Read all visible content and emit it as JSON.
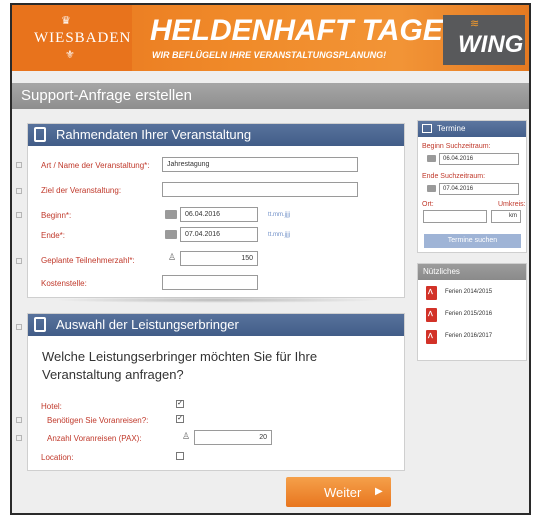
{
  "banner": {
    "logo_text": "WIESBADEN",
    "headline": "HELDENHAFT TAGEN",
    "tagline": "WIR BEFLÜGELN IHRE VERANSTALTUNGSPLANUNG!",
    "brand": "WING"
  },
  "page": {
    "title": "Support-Anfrage erstellen"
  },
  "rahmendaten": {
    "title": "Rahmendaten Ihrer Veranstaltung",
    "event_name_label": "Art / Name der Veranstaltung*:",
    "event_name_value": "Jahrestagung",
    "goal_label": "Ziel der Veranstaltung:",
    "goal_value": "",
    "start_label": "Beginn*:",
    "start_value": "06.04.2016",
    "end_label": "Ende*:",
    "end_value": "07.04.2016",
    "date_format_hint": "tt.mm.jjjj",
    "participants_label": "Geplante Teilnehmerzahl*:",
    "participants_value": "150",
    "cost_center_label": "Kostenstelle:",
    "cost_center_value": ""
  },
  "leistungen": {
    "title": "Auswahl der Leistungserbringer",
    "question": "Welche Leistungserbringer möchten Sie für Ihre Veranstaltung anfragen?",
    "hotel_label": "Hotel:",
    "hotel_checked": true,
    "preevent_label": "Benötigen Sie Voranreisen?:",
    "preevent_checked": true,
    "preevent_count_label": "Anzahl Voranreisen (PAX):",
    "preevent_count_value": "20",
    "location_label": "Location:",
    "location_checked": false,
    "check_mark": "✓"
  },
  "termine": {
    "title": "Termine",
    "start_label": "Beginn Suchzeitraum:",
    "start_value": "06.04.2016",
    "end_label": "Ende Suchzeitraum:",
    "end_value": "07.04.2016",
    "place_label": "Ort:",
    "radius_label": "Umkreis:",
    "radius_unit": "km",
    "search_button": "Termine suchen"
  },
  "nuetzliches": {
    "title": "Nützliches",
    "docs": [
      "Ferien 2014/2015",
      "Ferien 2015/2016",
      "Ferien 2016/2017"
    ]
  },
  "actions": {
    "next_label": "Weiter",
    "next_arrow": "▶"
  },
  "colors": {
    "accent_orange": "#f08b2a",
    "panel_blue": "#4b6692",
    "label_red": "#c0392b",
    "brand_gray": "#58595b"
  }
}
